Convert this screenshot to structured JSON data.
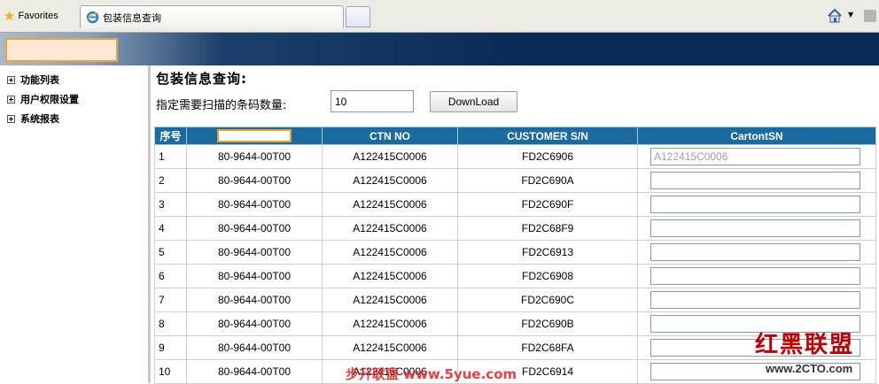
{
  "browser": {
    "favorites_label": "Favorites",
    "tab_title": "包装信息查询",
    "icons": {
      "favorites": "star-icon",
      "tab": "ie-icon",
      "home": "home-icon",
      "feeds": "rss-icon"
    }
  },
  "sidebar": {
    "items": [
      {
        "label": "功能列表"
      },
      {
        "label": "用户权限设置"
      },
      {
        "label": "系统报表"
      }
    ]
  },
  "main": {
    "title": "包装信息查询:",
    "scan_label": "指定需要扫描的条码数量:",
    "scan_count": "10",
    "download_label": "DownLoad"
  },
  "table": {
    "headers": [
      "序号",
      "",
      "CTN NO",
      "CUSTOMER S/N",
      "CartontSN"
    ],
    "rows": [
      {
        "idx": "1",
        "part": "80-9644-00T00",
        "ctn": "A122415C0006",
        "customer_sn": "FD2C6906",
        "carton_sn": "A122415C0006"
      },
      {
        "idx": "2",
        "part": "80-9644-00T00",
        "ctn": "A122415C0006",
        "customer_sn": "FD2C690A",
        "carton_sn": ""
      },
      {
        "idx": "3",
        "part": "80-9644-00T00",
        "ctn": "A122415C0006",
        "customer_sn": "FD2C690F",
        "carton_sn": ""
      },
      {
        "idx": "4",
        "part": "80-9644-00T00",
        "ctn": "A122415C0006",
        "customer_sn": "FD2C68F9",
        "carton_sn": ""
      },
      {
        "idx": "5",
        "part": "80-9644-00T00",
        "ctn": "A122415C0006",
        "customer_sn": "FD2C6913",
        "carton_sn": ""
      },
      {
        "idx": "6",
        "part": "80-9644-00T00",
        "ctn": "A122415C0006",
        "customer_sn": "FD2C6908",
        "carton_sn": ""
      },
      {
        "idx": "7",
        "part": "80-9644-00T00",
        "ctn": "A122415C0006",
        "customer_sn": "FD2C690C",
        "carton_sn": ""
      },
      {
        "idx": "8",
        "part": "80-9644-00T00",
        "ctn": "A122415C0006",
        "customer_sn": "FD2C690B",
        "carton_sn": ""
      },
      {
        "idx": "9",
        "part": "80-9644-00T00",
        "ctn": "A122415C0006",
        "customer_sn": "FD2C68FA",
        "carton_sn": ""
      },
      {
        "idx": "10",
        "part": "80-9644-00T00",
        "ctn": "A122415C0006",
        "customer_sn": "FD2C6914",
        "carton_sn": ""
      }
    ]
  },
  "watermarks": {
    "center": "步升联盟 www.5yue.com",
    "corner_title": "红黑联盟",
    "corner_url": "www.2CTO.com"
  },
  "colors": {
    "header_bg": "#1b6aa0",
    "banner": "#0a2a55",
    "highlight_border": "#f0a040"
  }
}
